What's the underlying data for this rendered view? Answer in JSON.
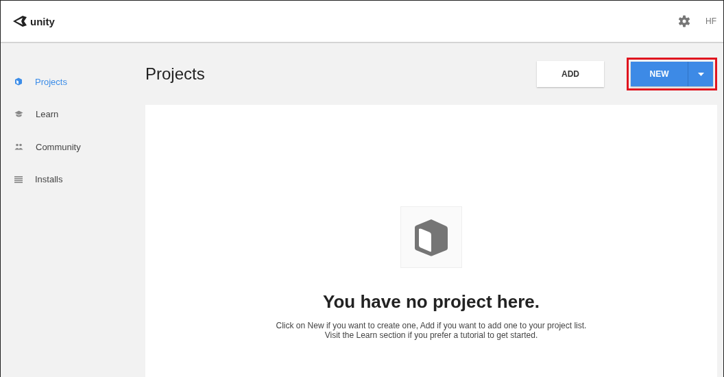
{
  "header": {
    "logo_text": "unity",
    "user_initials": "HF"
  },
  "sidebar": {
    "items": [
      {
        "label": "Projects",
        "kind": "cube",
        "selected": true
      },
      {
        "label": "Learn",
        "kind": "cap",
        "selected": false
      },
      {
        "label": "Community",
        "kind": "people",
        "selected": false
      },
      {
        "label": "Installs",
        "kind": "list",
        "selected": false
      }
    ]
  },
  "page": {
    "title": "Projects",
    "add_button": "ADD",
    "new_button": "NEW",
    "new_highlighted": true
  },
  "empty_state": {
    "heading": "You have no project here.",
    "message": "Click on New if you want to create one, Add if you want to add one to your project list. Visit the Learn section if you prefer a tutorial to get started."
  }
}
